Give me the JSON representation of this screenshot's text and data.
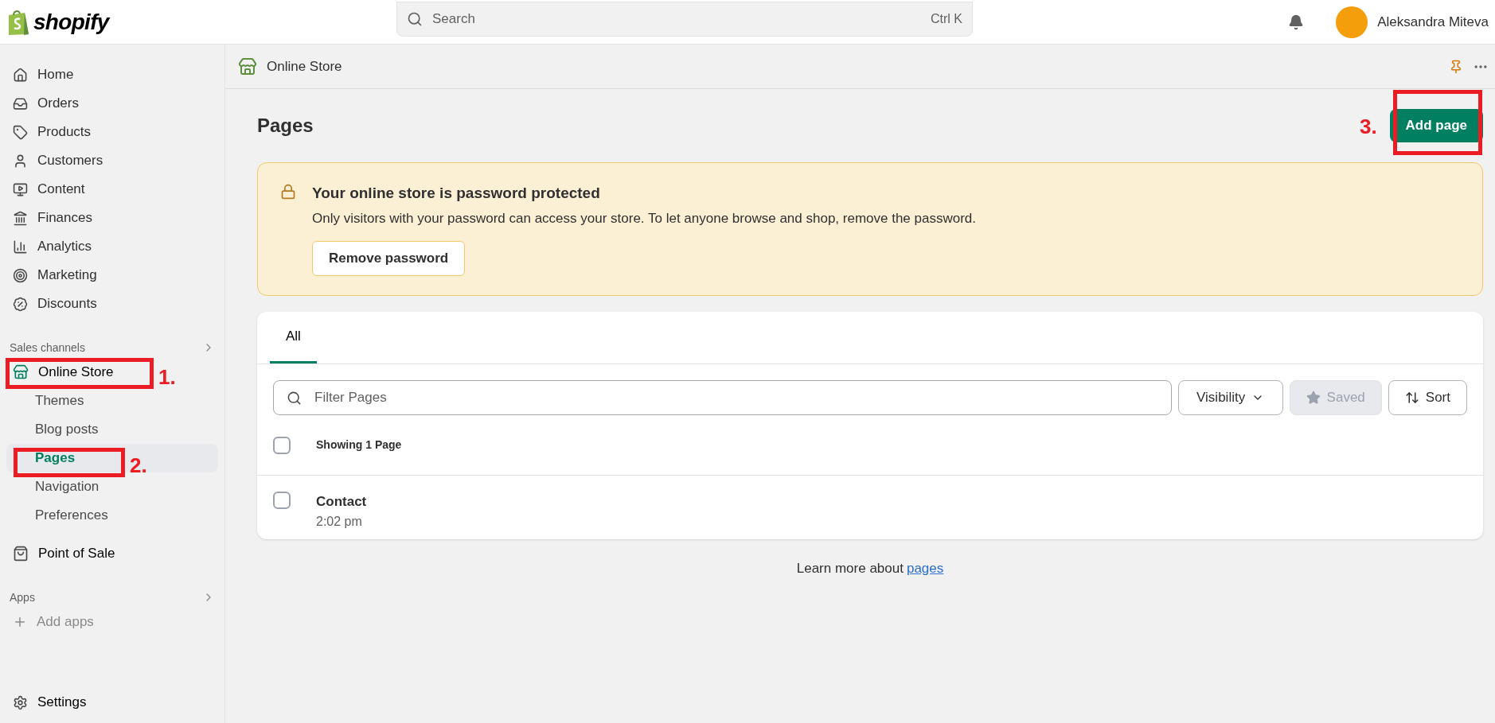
{
  "topbar": {
    "logo_text": "shopify",
    "search": {
      "placeholder": "Search",
      "shortcut": "Ctrl K"
    },
    "user": {
      "name": "Aleksandra Miteva"
    }
  },
  "sidebar": {
    "items": [
      {
        "label": "Home",
        "selected": false
      },
      {
        "label": "Orders",
        "selected": false
      },
      {
        "label": "Products",
        "selected": false
      },
      {
        "label": "Customers",
        "selected": false
      },
      {
        "label": "Content",
        "selected": false
      },
      {
        "label": "Finances",
        "selected": false
      },
      {
        "label": "Analytics",
        "selected": false
      },
      {
        "label": "Marketing",
        "selected": false
      },
      {
        "label": "Discounts",
        "selected": false
      }
    ],
    "sales_channels": {
      "title": "Sales channels",
      "channels": [
        {
          "label": "Online Store",
          "children": [
            {
              "label": "Themes",
              "selected": false
            },
            {
              "label": "Blog posts",
              "selected": false
            },
            {
              "label": "Pages",
              "selected": true
            },
            {
              "label": "Navigation",
              "selected": false
            },
            {
              "label": "Preferences",
              "selected": false
            }
          ]
        },
        {
          "label": "Point of Sale"
        }
      ]
    },
    "apps": {
      "title": "Apps",
      "items": [
        {
          "label": "Add apps"
        }
      ]
    },
    "settings": {
      "label": "Settings"
    }
  },
  "subheader": {
    "title": "Online Store"
  },
  "page": {
    "title": "Pages",
    "primary_action": "Add page"
  },
  "banner": {
    "title": "Your online store is password protected",
    "message": "Only visitors with your password can access your store. To let anyone browse and shop, remove the password.",
    "action": "Remove password"
  },
  "tabs": [
    {
      "label": "All",
      "selected": true
    }
  ],
  "filters": {
    "placeholder": "Filter Pages",
    "buttons": [
      {
        "kind": "dropdown",
        "label": "Visibility",
        "disabled": false
      },
      {
        "kind": "saved",
        "label": "Saved",
        "disabled": true
      },
      {
        "kind": "sort",
        "label": "Sort",
        "disabled": false
      }
    ]
  },
  "table": {
    "header": {
      "label": "Showing 1 Page",
      "checked": false
    },
    "rows": [
      {
        "title": "Contact",
        "time": "2:02 pm",
        "checked": false
      }
    ]
  },
  "footer": {
    "text": "Learn more about",
    "link": "pages"
  },
  "annotations": [
    {
      "label": "1."
    },
    {
      "label": "2."
    },
    {
      "label": "3."
    }
  ]
}
